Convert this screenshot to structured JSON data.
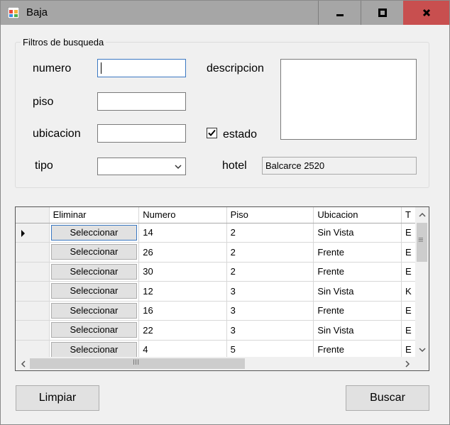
{
  "window": {
    "title": "Baja"
  },
  "filters": {
    "group_title": "Filtros de busqueda",
    "numero_label": "numero",
    "numero_value": "",
    "piso_label": "piso",
    "piso_value": "",
    "ubicacion_label": "ubicacion",
    "ubicacion_value": "",
    "tipo_label": "tipo",
    "tipo_value": "",
    "descripcion_label": "descripcion",
    "descripcion_value": "",
    "estado_label": "estado",
    "estado_checked": true,
    "hotel_label": "hotel",
    "hotel_value": "Balcarce 2520"
  },
  "grid": {
    "columns": [
      "Eliminar",
      "Numero",
      "Piso",
      "Ubicacion",
      "T"
    ],
    "button_label": "Seleccionar",
    "rows": [
      {
        "numero": "14",
        "piso": "2",
        "ubicacion": "Sin Vista",
        "tipo": "E"
      },
      {
        "numero": "26",
        "piso": "2",
        "ubicacion": "Frente",
        "tipo": "E"
      },
      {
        "numero": "30",
        "piso": "2",
        "ubicacion": "Frente",
        "tipo": "E"
      },
      {
        "numero": "12",
        "piso": "3",
        "ubicacion": "Sin Vista",
        "tipo": "K"
      },
      {
        "numero": "16",
        "piso": "3",
        "ubicacion": "Frente",
        "tipo": "E"
      },
      {
        "numero": "22",
        "piso": "3",
        "ubicacion": "Sin Vista",
        "tipo": "E"
      },
      {
        "numero": "4",
        "piso": "5",
        "ubicacion": "Frente",
        "tipo": "E"
      }
    ],
    "scroll_thumb_grip": "≡",
    "hscroll_thumb_grip": "III"
  },
  "actions": {
    "limpiar_label": "Limpiar",
    "buscar_label": "Buscar"
  },
  "colors": {
    "close_button": "#c84f4f",
    "focus_border": "#3b78c2"
  }
}
